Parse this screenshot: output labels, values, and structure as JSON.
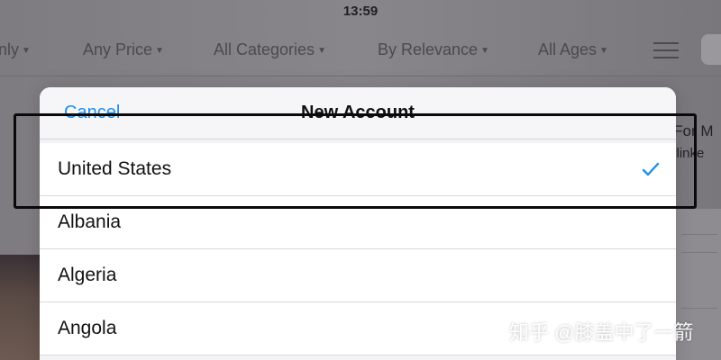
{
  "status_bar": {
    "time": "13:59"
  },
  "filters": {
    "items": [
      {
        "label": "nly",
        "icon": "caret-down-icon"
      },
      {
        "label": "Any Price",
        "icon": "caret-down-icon"
      },
      {
        "label": "All Categories",
        "icon": "caret-down-icon"
      },
      {
        "label": "By Relevance",
        "icon": "caret-down-icon"
      },
      {
        "label": "All Ages",
        "icon": "caret-down-icon"
      }
    ],
    "list_icon": "list-view-icon",
    "search_icon": "search-icon"
  },
  "background": {
    "snippet_1": "u For M",
    "snippet_2": "terlinke"
  },
  "sheet": {
    "cancel_label": "Cancel",
    "title": "New Account",
    "accent_color": "#1a8ff0",
    "rows": [
      {
        "label": "United States",
        "selected": true
      },
      {
        "label": "Albania",
        "selected": false
      },
      {
        "label": "Algeria",
        "selected": false
      },
      {
        "label": "Angola",
        "selected": false
      }
    ]
  },
  "watermark": {
    "text": "知乎 @膝盖中了一箭",
    "icon": "zhihu-logo"
  }
}
